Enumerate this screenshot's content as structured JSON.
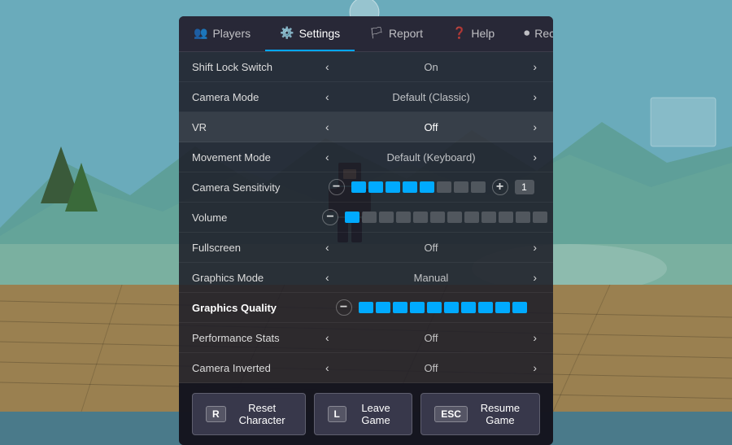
{
  "background": {
    "description": "Roblox game scene with mountains, water and wooden floor"
  },
  "tabs": [
    {
      "id": "players",
      "label": "Players",
      "icon": "👥",
      "active": false
    },
    {
      "id": "settings",
      "label": "Settings",
      "icon": "⚙️",
      "active": true
    },
    {
      "id": "report",
      "label": "Report",
      "icon": "🏳",
      "active": false
    },
    {
      "id": "help",
      "label": "Help",
      "icon": "❓",
      "active": false
    },
    {
      "id": "record",
      "label": "Record",
      "icon": "⏺",
      "active": false
    }
  ],
  "settings": [
    {
      "id": "shift-lock",
      "label": "Shift Lock Switch",
      "value": "On",
      "type": "toggle",
      "bold": false
    },
    {
      "id": "camera-mode",
      "label": "Camera Mode",
      "value": "Default (Classic)",
      "type": "toggle",
      "bold": false
    },
    {
      "id": "vr",
      "label": "VR",
      "value": "Off",
      "type": "toggle",
      "bold": false,
      "highlight": true
    },
    {
      "id": "movement-mode",
      "label": "Movement Mode",
      "value": "Default (Keyboard)",
      "type": "toggle",
      "bold": false
    },
    {
      "id": "camera-sensitivity",
      "label": "Camera Sensitivity",
      "value": "",
      "type": "slider",
      "blocks": 5,
      "total": 8,
      "badge": "1",
      "bold": false
    },
    {
      "id": "volume",
      "label": "Volume",
      "value": "",
      "type": "slider-long",
      "blocks": 1,
      "total": 12,
      "bold": false
    },
    {
      "id": "fullscreen",
      "label": "Fullscreen",
      "value": "Off",
      "type": "toggle",
      "bold": false
    },
    {
      "id": "graphics-mode",
      "label": "Graphics Mode",
      "value": "Manual",
      "type": "toggle",
      "bold": false
    },
    {
      "id": "graphics-quality",
      "label": "Graphics Quality",
      "value": "",
      "type": "slider-blocks",
      "blocks": 10,
      "total": 10,
      "bold": true
    },
    {
      "id": "performance-stats",
      "label": "Performance Stats",
      "value": "Off",
      "type": "toggle",
      "bold": false
    },
    {
      "id": "camera-inverted",
      "label": "Camera Inverted",
      "value": "Off",
      "type": "toggle",
      "bold": false
    }
  ],
  "buttons": [
    {
      "id": "reset",
      "key": "R",
      "label": "Reset Character"
    },
    {
      "id": "leave",
      "key": "L",
      "label": "Leave Game"
    },
    {
      "id": "resume",
      "key": "ESC",
      "label": "Resume Game"
    }
  ]
}
